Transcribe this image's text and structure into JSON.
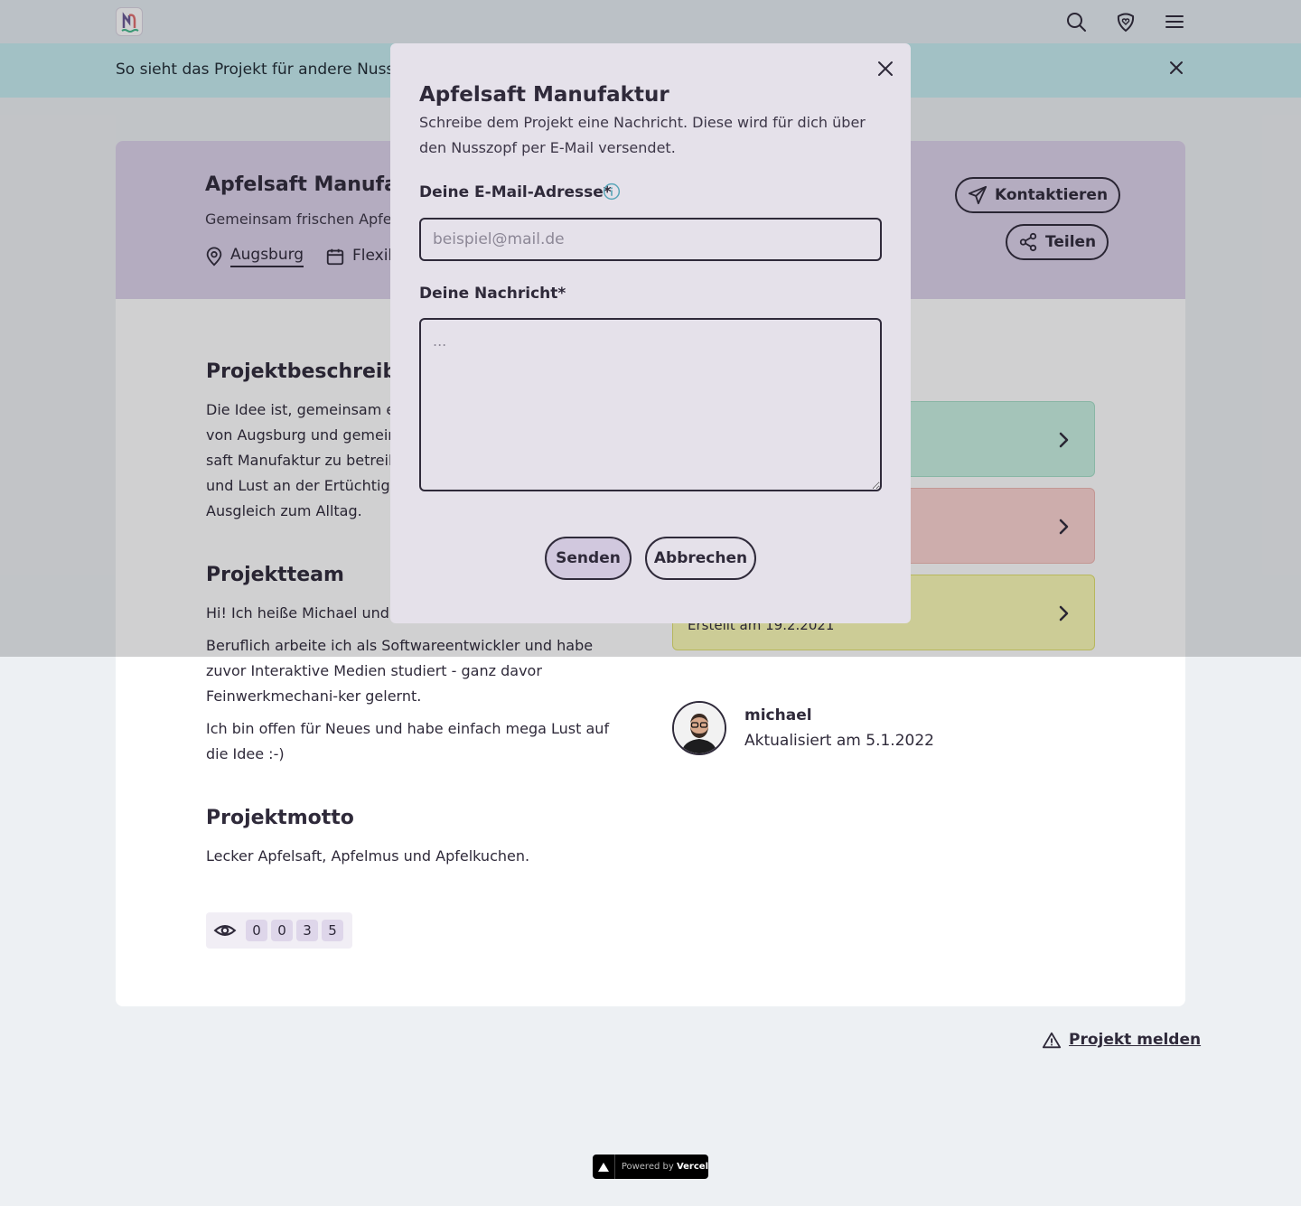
{
  "nav": {
    "logo_icon": "nusszopf-logo-icon",
    "search_icon": "search-icon",
    "heart_icon": "heart-shield-icon",
    "menu_icon": "hamburger-menu-icon"
  },
  "banner": {
    "text": "So sieht das Projekt für andere Nusszop",
    "close_icon": "close-icon"
  },
  "project": {
    "title": "Apfelsaft Manufaktu",
    "subtitle": "Gemeinsam frischen Apfel",
    "location": "Augsburg",
    "time": "Flexib",
    "contact_label": "Kontaktieren",
    "share_label": "Teilen"
  },
  "description": {
    "heading": "Projektbeschreibun",
    "lines": [
      "Die Idee ist, gemeinsam ei",
      "von Augsburg und gemeins",
      "saft Manufaktur zu betreib",
      "und Lust an der Ertüchtigu",
      "Ausgleich zum Alltag."
    ]
  },
  "team": {
    "heading": "Projektteam",
    "p1": "Hi! Ich heiße Michael und fr",
    "p2": "Beruflich arbeite ich als Softwareentwickler und habe zuvor Interaktive Medien studiert - ganz davor Feinwerkmechani-ker gelernt.",
    "p3": "Ich bin offen für Neues und habe einfach mega Lust auf die Idee :-)"
  },
  "motto": {
    "heading": "Projektmotto",
    "text": "Lecker Apfelsaft, Apfelmus und Apfelkuchen."
  },
  "views": {
    "icon": "eye-icon",
    "digits": [
      "0",
      "0",
      "3",
      "5"
    ]
  },
  "tiles": {
    "tile3_text": "Erstellt am 19.2.2021",
    "colors": [
      "#c9f1e1",
      "#fcd4d1",
      "#fbfbb6"
    ]
  },
  "author": {
    "name": "michael",
    "updated": "Aktualisiert am 5.1.2022"
  },
  "report": {
    "label": "Projekt melden"
  },
  "footer": {
    "vercel_prefix": "Powered by ",
    "vercel_brand": "Vercel"
  },
  "modal": {
    "title": "Apfelsaft Manufaktur",
    "description": "Schreibe dem Projekt eine Nachricht. Diese wird für dich über den Nusszopf per E-Mail versendet.",
    "email_label": "Deine E-Mail-Adresse*",
    "email_placeholder": "beispiel@mail.de",
    "email_value": "",
    "message_label": "Deine Nachricht*",
    "message_placeholder": "...",
    "message_value": "",
    "send_label": "Senden",
    "cancel_label": "Abbrechen"
  },
  "colors": {
    "text": "#2f2a3a",
    "nav_bg": "#e5edf2",
    "banner_bg": "#c6edf1",
    "header_bg": "#ddd2ea",
    "modal_bg": "#e5e1ea",
    "send_bg": "#d1c8de"
  }
}
